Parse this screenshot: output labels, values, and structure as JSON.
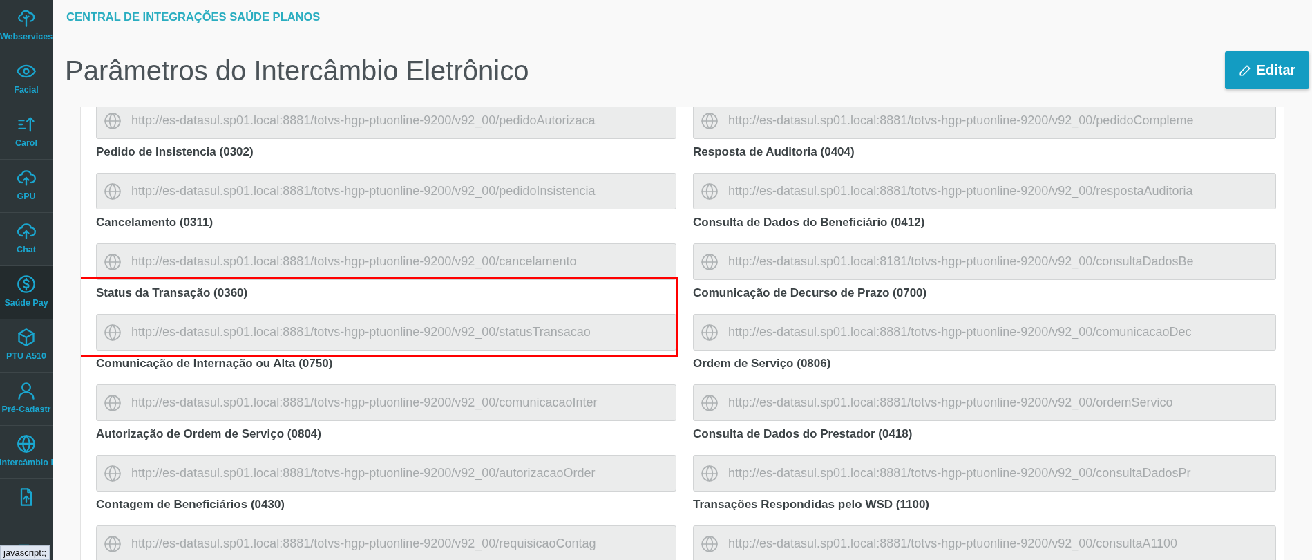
{
  "sidebar": {
    "items": [
      {
        "label": "Webservices",
        "selected": false
      },
      {
        "label": "Facial",
        "selected": false
      },
      {
        "label": "Carol",
        "selected": false
      },
      {
        "label": "GPU",
        "selected": false
      },
      {
        "label": "Chat",
        "selected": false
      },
      {
        "label": "Saúde Pay",
        "selected": true
      },
      {
        "label": "PTU A510",
        "selected": false
      },
      {
        "label": "Pré-Cadastr",
        "selected": false
      },
      {
        "label": "Intercâmbio I",
        "selected": false
      },
      {
        "selected": false
      },
      {
        "selected": false
      }
    ]
  },
  "header": {
    "breadcrumb": "CENTRAL DE INTEGRAÇÕES SAÚDE PLANOS",
    "title": "Parâmetros do Intercâmbio Eletrônico",
    "edit_button": "Editar"
  },
  "fields": [
    {
      "url": "http://es-datasul.sp01.local:8881/totvs-hgp-ptuonline-9200/v92_00/pedidoAutorizaca",
      "highlighted": false
    },
    {
      "url": "http://es-datasul.sp01.local:8881/totvs-hgp-ptuonline-9200/v92_00/pedidoCompleme",
      "highlighted": false
    },
    {
      "label": "Pedido de Insistencia (0302)",
      "url": "http://es-datasul.sp01.local:8881/totvs-hgp-ptuonline-9200/v92_00/pedidoInsistencia",
      "highlighted": false
    },
    {
      "label": "Resposta de Auditoria (0404)",
      "url": "http://es-datasul.sp01.local:8881/totvs-hgp-ptuonline-9200/v92_00/respostaAuditoria",
      "highlighted": false
    },
    {
      "label": "Cancelamento (0311)",
      "url": "http://es-datasul.sp01.local:8881/totvs-hgp-ptuonline-9200/v92_00/cancelamento",
      "highlighted": false
    },
    {
      "label": "Consulta de Dados do Beneficiário (0412)",
      "url": "http://es-datasul.sp01.local:8181/totvs-hgp-ptuonline-9200/v92_00/consultaDadosBe",
      "highlighted": false
    },
    {
      "label": "Status da Transação (0360)",
      "url": "http://es-datasul.sp01.local:8881/totvs-hgp-ptuonline-9200/v92_00/statusTransacao",
      "highlighted": true
    },
    {
      "label": "Comunicação de Decurso de Prazo (0700)",
      "url": "http://es-datasul.sp01.local:8881/totvs-hgp-ptuonline-9200/v92_00/comunicacaoDec",
      "highlighted": false
    },
    {
      "label": "Comunicação de Internação ou Alta (0750)",
      "url": "http://es-datasul.sp01.local:8881/totvs-hgp-ptuonline-9200/v92_00/comunicacaoInter",
      "highlighted": false
    },
    {
      "label": "Ordem de Serviço (0806)",
      "url": "http://es-datasul.sp01.local:8881/totvs-hgp-ptuonline-9200/v92_00/ordemServico",
      "highlighted": false
    },
    {
      "label": "Autorização de Ordem de Serviço (0804)",
      "url": "http://es-datasul.sp01.local:8881/totvs-hgp-ptuonline-9200/v92_00/autorizacaoOrder",
      "highlighted": false
    },
    {
      "label": "Consulta de Dados do Prestador (0418)",
      "url": "http://es-datasul.sp01.local:8881/totvs-hgp-ptuonline-9200/v92_00/consultaDadosPr",
      "highlighted": false
    },
    {
      "label": "Contagem de Beneficiários (0430)",
      "url": "http://es-datasul.sp01.local:8881/totvs-hgp-ptuonline-9200/v92_00/requisicaoContag",
      "highlighted": false
    },
    {
      "label": "Transações Respondidas pelo WSD (1100)",
      "url": "http://es-datasul.sp01.local:8881/totvs-hgp-ptuonline-9200/v92_00/consultaA1100",
      "highlighted": false
    }
  ],
  "status_bar": "javascript:;"
}
